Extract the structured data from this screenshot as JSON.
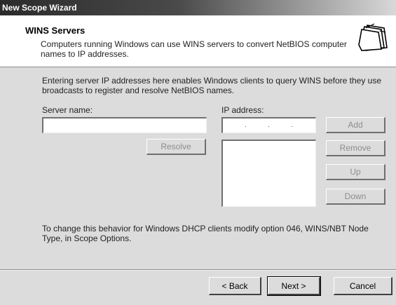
{
  "window": {
    "title": "New Scope Wizard"
  },
  "header": {
    "title": "WINS Servers",
    "description": "Computers running Windows can use WINS servers to convert NetBIOS computer names to IP addresses.",
    "icon": "folders-icon"
  },
  "content": {
    "intro": "Entering server IP addresses here enables Windows clients to query WINS before they use broadcasts to register and resolve NetBIOS names.",
    "server_name_label": "Server name:",
    "server_name_value": "",
    "ip_label": "IP address:",
    "ip_value": ". . .",
    "resolve_label": "Resolve",
    "add_label": "Add",
    "remove_label": "Remove",
    "up_label": "Up",
    "down_label": "Down",
    "ip_list": [],
    "note": "To change this behavior for Windows DHCP clients modify option 046, WINS/NBT Node Type, in Scope Options."
  },
  "footer": {
    "back_label": "< Back",
    "next_label": "Next >",
    "cancel_label": "Cancel"
  }
}
